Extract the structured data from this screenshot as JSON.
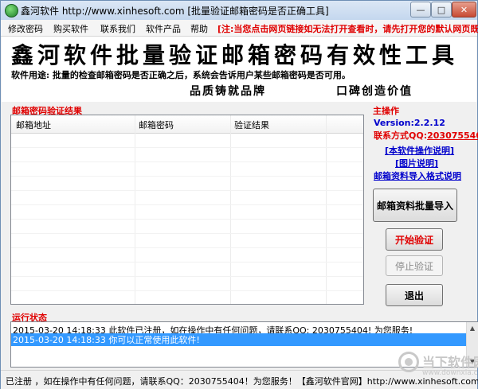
{
  "window": {
    "title": "鑫河软件 http://www.xinhesoft.com [批量验证邮箱密码是否正确工具]",
    "min_glyph": "—",
    "max_glyph": "□",
    "close_glyph": "✕"
  },
  "menu": {
    "items": [
      {
        "label": "修改密码"
      },
      {
        "label": "购买软件"
      },
      {
        "label": "联系我们"
      },
      {
        "label": "软件产品"
      },
      {
        "label": "帮助"
      }
    ],
    "notice": "[注:当您点击网页链接如无法打开查看时，请先打开您的默认网页既可]"
  },
  "banner": {
    "title": "鑫河软件批量验证邮箱密码有效性工具",
    "subtitle": "软件用途: 批量的检查邮箱密码是否正确之后，系统会告诉用户某些邮箱密码是否可用。",
    "slogan_a": "品质铸就品牌",
    "slogan_b": "口碑创造价值"
  },
  "results": {
    "section_title": "邮箱密码验证结果",
    "columns": [
      "邮箱地址",
      "邮箱密码",
      "验证结果"
    ],
    "rows": []
  },
  "main_ops": {
    "section_title": "主操作",
    "version": "Version:2.2.12",
    "contact_label": "联系方式QQ:",
    "contact_qq": "2030755404",
    "links": [
      {
        "label": "[本软件操作说明]"
      },
      {
        "label": "[图片说明]"
      },
      {
        "label": "邮箱资料导入格式说明"
      }
    ],
    "buttons": {
      "import": "邮箱资料批量导入",
      "start": "开始验证",
      "stop": "停止验证",
      "exit": "退出"
    }
  },
  "log": {
    "section_title": "运行状态",
    "lines": [
      "2015-03-20 14:18:33  此软件已注册，如在操作中有任何问题，请联系QQ: 2030755404! 为您服务!",
      "2015-03-20 14:18:33  你可以正常使用此软件!"
    ],
    "selected_index": 1,
    "scroll_up": "▲",
    "scroll_down": "▼"
  },
  "status_bar": {
    "text": "已注册 ，如在操作中有任何问题，请联系QQ：2030755404！为您服务！【鑫河软件官网】http://www.xinhesoft.com"
  },
  "watermark": {
    "text": "当下软件园",
    "url": "www.downxia.com"
  },
  "colors": {
    "accent_red": "#e00000",
    "link_blue": "#0000cc",
    "selection_blue": "#3399ff"
  }
}
